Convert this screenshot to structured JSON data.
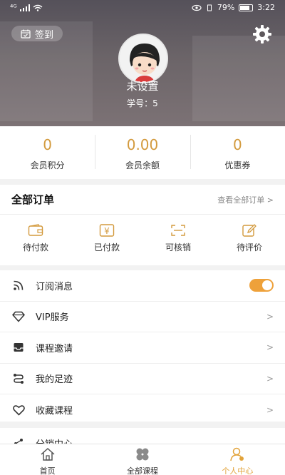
{
  "status_bar": {
    "signal": "⁴ᴳ",
    "battery_pct": "79%",
    "time": "3:22"
  },
  "header": {
    "checkin_label": "签到",
    "username": "未设置",
    "student_no": "学号：5"
  },
  "stats": [
    {
      "value": "0",
      "label": "会员积分"
    },
    {
      "value": "0.00",
      "label": "会员余额"
    },
    {
      "value": "0",
      "label": "优惠券"
    }
  ],
  "orders": {
    "title": "全部订单",
    "view_all": "查看全部订单  >",
    "items": [
      {
        "label": "待付款",
        "icon": "wallet-icon"
      },
      {
        "label": "已付款",
        "icon": "yuan-icon"
      },
      {
        "label": "可核销",
        "icon": "scan-icon"
      },
      {
        "label": "待评价",
        "icon": "edit-icon"
      }
    ]
  },
  "menu": [
    {
      "label": "订阅消息",
      "icon": "rss-icon",
      "toggle_on": true
    },
    {
      "label": "VIP服务",
      "icon": "diamond-icon"
    },
    {
      "label": "课程邀请",
      "icon": "inbox-icon"
    },
    {
      "label": "我的足迹",
      "icon": "route-icon"
    },
    {
      "label": "收藏课程",
      "icon": "heart-icon"
    }
  ],
  "menu_partial": {
    "label": "分销中心"
  },
  "tabbar": [
    {
      "label": "首页",
      "icon": "home-icon"
    },
    {
      "label": "全部课程",
      "icon": "clover-icon"
    },
    {
      "label": "个人中心",
      "icon": "user-icon",
      "active": true
    }
  ],
  "colors": {
    "accent": "#d39a3d",
    "toggle": "#eea13a"
  }
}
